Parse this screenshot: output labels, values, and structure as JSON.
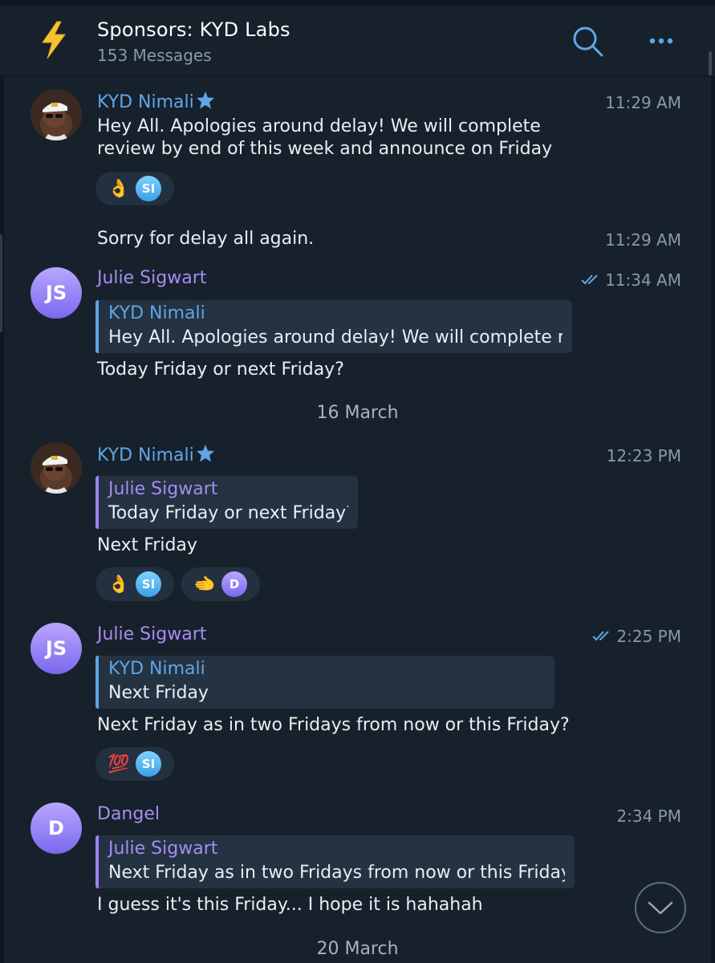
{
  "header": {
    "title": "Sponsors: KYD Labs",
    "subtitle": "153 Messages",
    "icon": "lightning-bolt-icon",
    "actions": [
      "search-icon",
      "more-icon"
    ]
  },
  "colors": {
    "background": "#17212b",
    "accent_blue": "#5fa6e6",
    "accent_purple": "#a58df2",
    "reply_bg": "#243241"
  },
  "messages": [
    {
      "sender": "KYD Nimali",
      "time": "11:29 AM",
      "text_line1": "Hey All. Apologies around delay! We will complete",
      "text_line2": "review by end of this week and announce on Friday",
      "reactions": [
        {
          "emoji": "👌",
          "avatar": "SI"
        }
      ]
    },
    {
      "time": "11:29 AM",
      "text": "Sorry for delay all again."
    },
    {
      "sender": "Julie Sigwart",
      "initials": "JS",
      "time": "11:34 AM",
      "reply_name": "KYD Nimali",
      "reply_text": "Hey All. Apologies around delay! We will complete r...",
      "text": "Today Friday or next Friday?"
    },
    {
      "sender": "KYD Nimali",
      "time": "12:23 PM",
      "reply_name": "Julie Sigwart",
      "reply_text": "Today Friday or next Friday?",
      "text": "Next Friday",
      "reactions": [
        {
          "emoji": "👌",
          "avatar": "SI"
        },
        {
          "emoji": "🫲",
          "avatar": "D"
        }
      ]
    },
    {
      "sender": "Julie Sigwart",
      "initials": "JS",
      "time": "2:25 PM",
      "reply_name": "KYD Nimali",
      "reply_text": "Next Friday",
      "text": "Next Friday as in two Fridays from now or this Friday?",
      "reactions": [
        {
          "emoji": "💯",
          "avatar": "SI"
        }
      ]
    },
    {
      "sender": "Dangel",
      "initials": "D",
      "time": "2:34 PM",
      "reply_name": "Julie Sigwart",
      "reply_text": "Next Friday as in two Fridays from now or this Friday?",
      "text": "I guess it's this Friday... I hope it is hahahah"
    }
  ],
  "date_separators": [
    "16 March",
    "20 March"
  ]
}
